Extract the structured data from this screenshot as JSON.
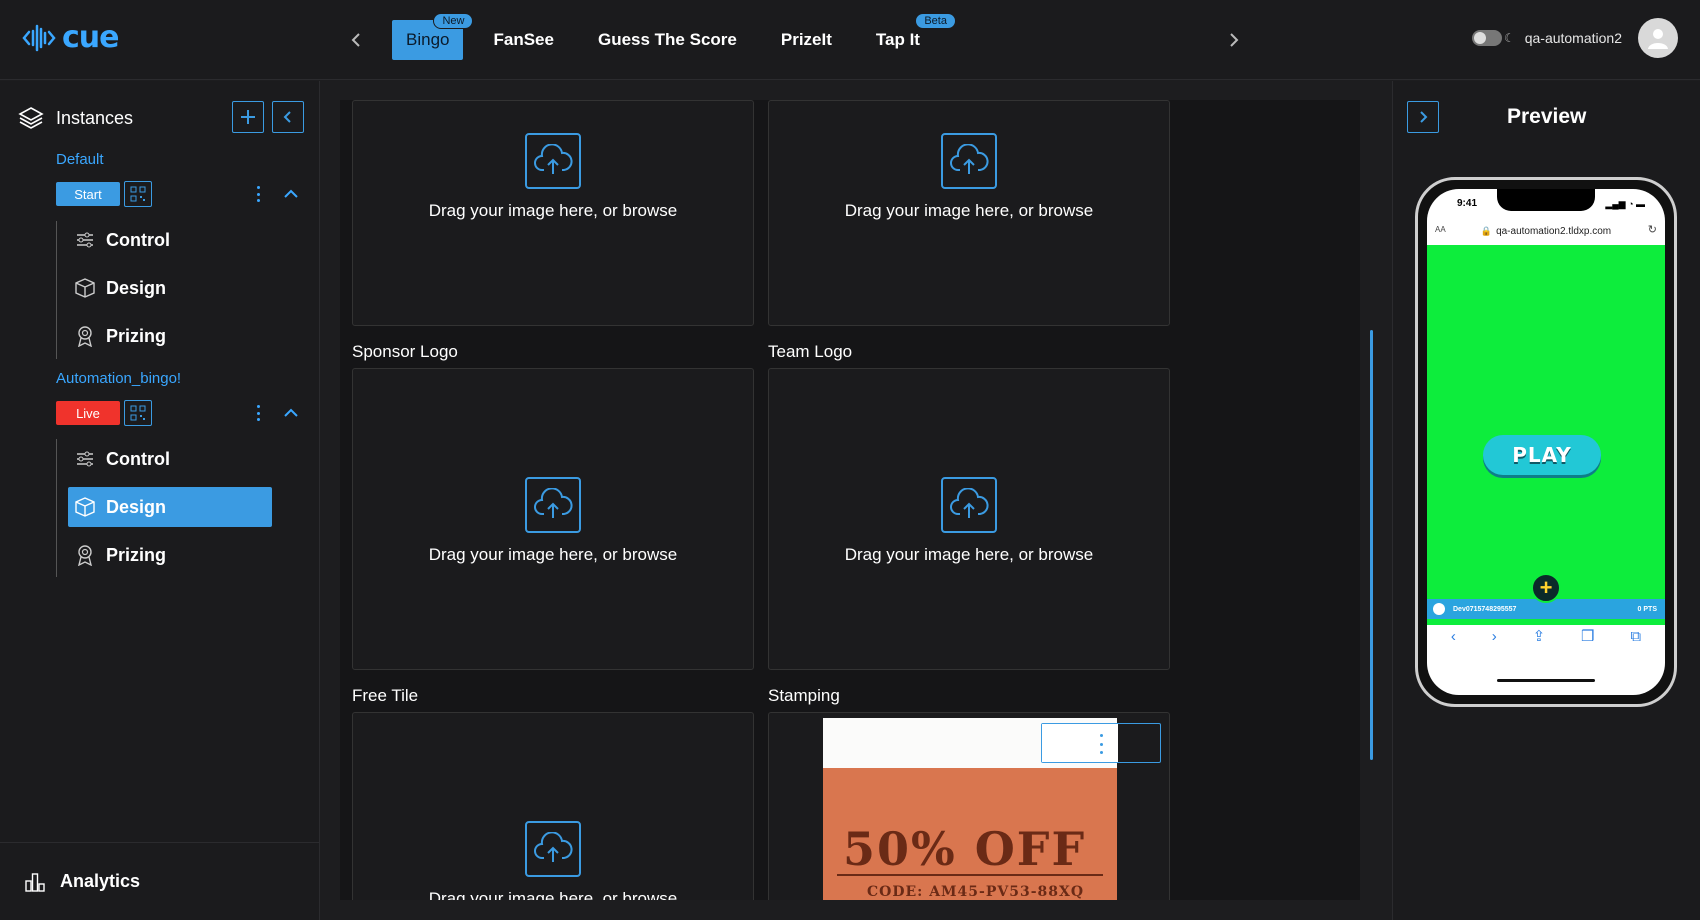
{
  "app": {
    "logo_text": "cue"
  },
  "header": {
    "tabs": [
      {
        "label": "Bingo",
        "badge": "New",
        "active": true
      },
      {
        "label": "FanSee",
        "badge": ""
      },
      {
        "label": "Guess The Score",
        "badge": ""
      },
      {
        "label": "PrizeIt",
        "badge": ""
      },
      {
        "label": "Tap It",
        "badge": "Beta"
      }
    ],
    "username": "qa-automation2"
  },
  "sidebar": {
    "title": "Instances",
    "instances": [
      {
        "name": "Default",
        "status": "Start",
        "status_color": "#3b9be2",
        "menu": [
          "Control",
          "Design",
          "Prizing"
        ],
        "active_item": ""
      },
      {
        "name": "Automation_bingo!",
        "status": "Live",
        "status_color": "#f0332c",
        "menu": [
          "Control",
          "Design",
          "Prizing"
        ],
        "active_item": "Design"
      }
    ],
    "footer": "Analytics"
  },
  "main": {
    "upload_text": "Drag your image here, or browse",
    "tiles": [
      {
        "label": ""
      },
      {
        "label": ""
      },
      {
        "label": "Sponsor Logo"
      },
      {
        "label": "Team Logo"
      },
      {
        "label": "Free Tile"
      },
      {
        "label": "Stamping"
      }
    ],
    "stamping_image": {
      "headline": "50% OFF",
      "code": "CODE: AM45-PV53-88XQ"
    }
  },
  "preview": {
    "title": "Preview",
    "phone": {
      "time": "9:41",
      "url": "qa-automation2.tldxp.com",
      "aa": "AA",
      "play_label": "PLAY",
      "user_id": "Dev0715748295557",
      "points": "0 PTS",
      "game_bg": "#0ded3c"
    }
  },
  "colors": {
    "accent": "#3b9be2",
    "live": "#f0332c",
    "background": "#1d1d1f"
  }
}
